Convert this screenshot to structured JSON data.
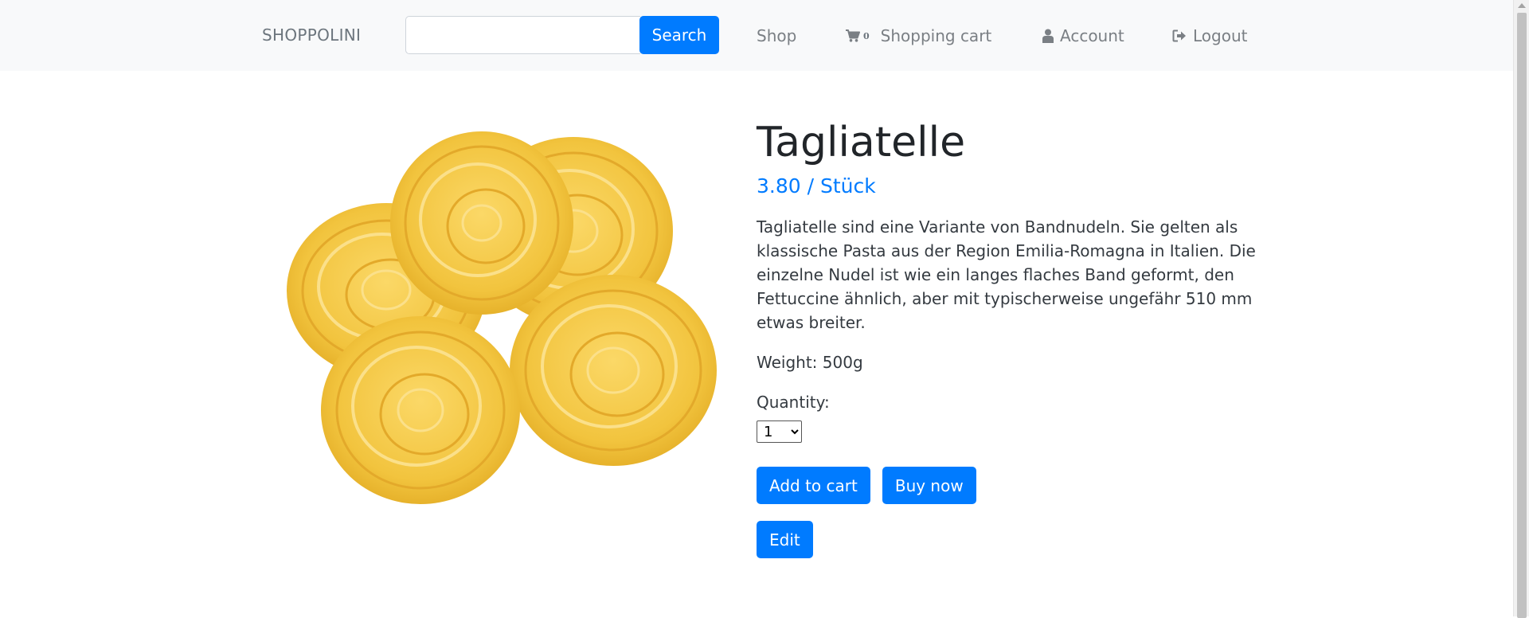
{
  "nav": {
    "brand": "SHOPPOLINI",
    "search_placeholder": "",
    "search_button": "Search",
    "shop": "Shop",
    "cart_count": "0",
    "cart": "Shopping cart",
    "account": "Account",
    "logout": "Logout"
  },
  "product": {
    "title": "Tagliatelle",
    "price": "3.80 / Stück",
    "description": "Tagliatelle sind eine Variante von Bandnudeln. Sie gelten als klassische Pasta aus der Region Emilia-Romagna in Italien. Die einzelne Nudel ist wie ein langes flaches Band geformt, den Fettuccine ähnlich, aber mit typischerweise ungefähr 510 mm etwas breiter.",
    "weight": "Weight: 500g",
    "quantity_label": "Quantity:",
    "quantity_value": "1",
    "add_to_cart": "Add to cart",
    "buy_now": "Buy now",
    "edit": "Edit"
  },
  "colors": {
    "primary": "#007bff",
    "navbar_bg": "#f8f9fa",
    "nav_text": "#7a7f84",
    "pasta": "#f5c84a"
  },
  "icons": {
    "cart": "shopping-cart-icon",
    "account": "user-icon",
    "logout": "sign-out-icon"
  }
}
